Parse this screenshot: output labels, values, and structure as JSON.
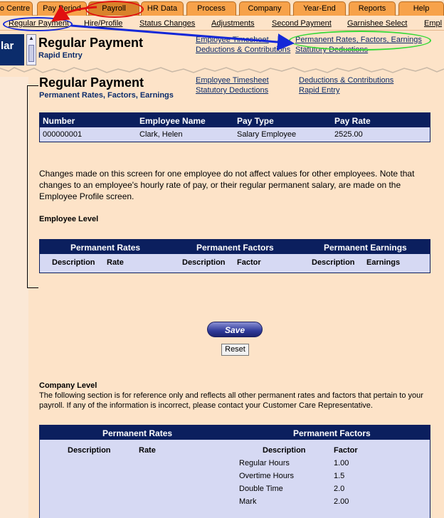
{
  "tabs": [
    "o Centre",
    "Pay Period",
    "Payroll",
    "HR Data",
    "Process",
    "Company",
    "Year-End",
    "Reports",
    "Help"
  ],
  "subnav": [
    "Regular Payment",
    "Hire/Profile",
    "Status Changes",
    "Adjustments",
    "Second Payment",
    "Garnishee Select",
    "Empl"
  ],
  "background": {
    "left_tab": "lar",
    "title": "Regular Payment",
    "subtitle": "Rapid Entry",
    "links": [
      "Employee Timesheet",
      "Deductions & Contributions",
      "Permanent Rates, Factors, Earnings",
      "Statutory Deductions"
    ]
  },
  "main": {
    "title": "Regular Payment",
    "subtitle": "Permanent Rates, Factors, Earnings",
    "links": [
      "Employee Timesheet",
      "Statutory Deductions",
      "Deductions & Contributions",
      "Rapid Entry"
    ],
    "employee_table": {
      "headers": [
        "Number",
        "Employee Name",
        "Pay Type",
        "Pay Rate"
      ],
      "row": [
        "000000001",
        "Clark, Helen",
        "Salary Employee",
        "2525.00"
      ]
    },
    "note": "Changes made on this screen for one employee do not affect values for other employees. Note that changes to an employee's hourly rate of pay, or their regular permanent salary, are made on the Employee Profile screen.",
    "employee_level_label": "Employee Level",
    "emp_level_table": {
      "groups": [
        "Permanent Rates",
        "Permanent Factors",
        "Permanent Earnings"
      ],
      "cols": [
        "Description",
        "Rate",
        "Description",
        "Factor",
        "Description",
        "Earnings"
      ]
    },
    "save_label": "Save",
    "reset_label": "Reset",
    "company_level_label": "Company Level",
    "company_note": "The following section is for reference only and reflects all other permanent rates and factors that pertain to your payroll. If any of the information is incorrect, please contact your Customer Care Representative.",
    "company_table": {
      "groups": [
        "Permanent Rates",
        "Permanent Factors"
      ],
      "cols": [
        "Description",
        "Rate",
        "Description",
        "Factor"
      ],
      "factors": [
        {
          "description": "Regular Hours",
          "factor": "1.00"
        },
        {
          "description": "Overtime Hours",
          "factor": "1.5"
        },
        {
          "description": "Double Time",
          "factor": "2.0"
        },
        {
          "description": "Mark",
          "factor": "2.00"
        }
      ]
    }
  },
  "colors": {
    "tab": "#f7a24a",
    "navy": "#0b1f5e",
    "annotation_red": "#e01010",
    "annotation_blue": "#1428d8",
    "annotation_green": "#38d838"
  }
}
